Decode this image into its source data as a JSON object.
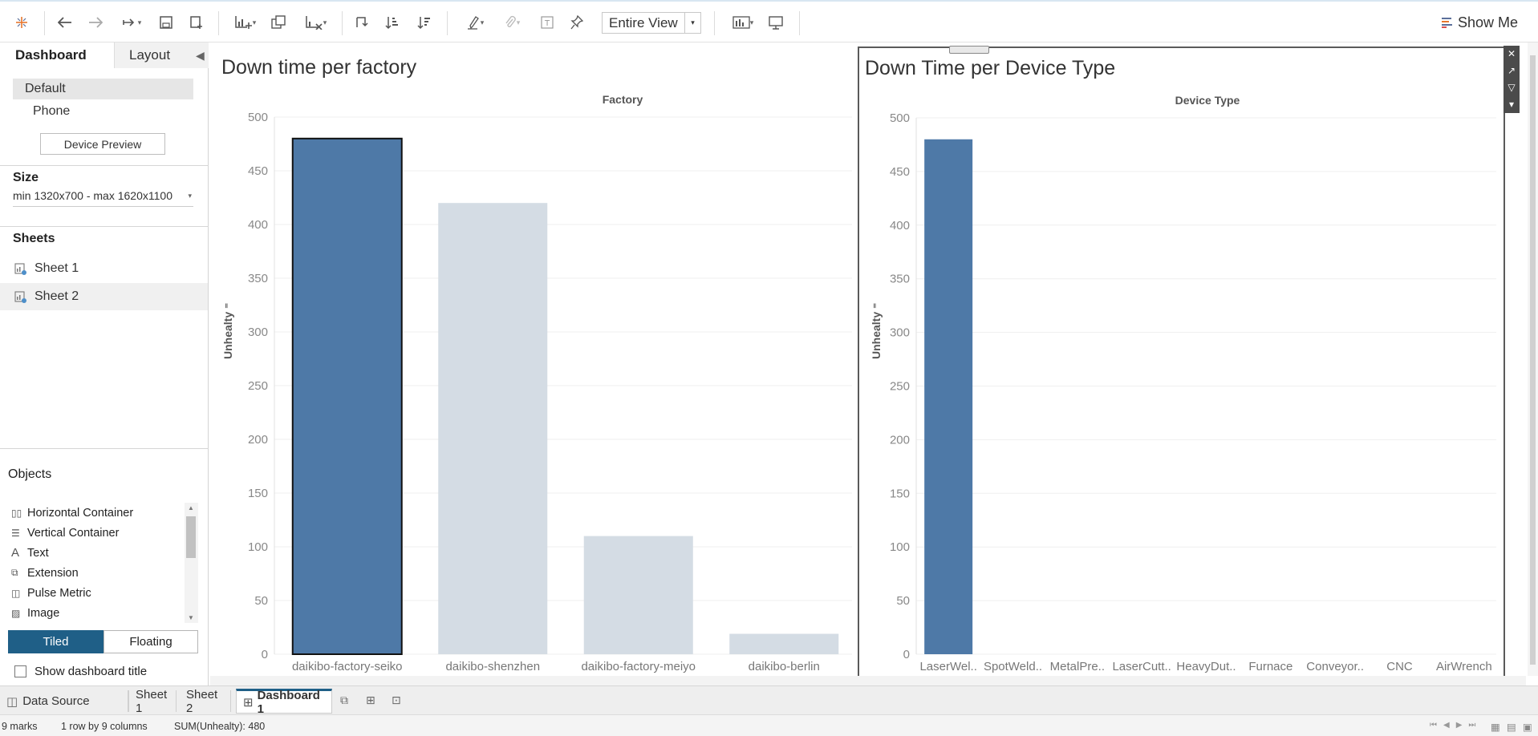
{
  "toolbar": {
    "view_select": "Entire View",
    "show_me": "Show Me",
    "icons": [
      "tableau-logo-icon",
      "undo-icon",
      "redo-icon",
      "replay-icon",
      "save-icon",
      "new-datasource-icon",
      "new-worksheet-icon",
      "duplicate-icon",
      "clear-icon",
      "swap-icon",
      "sort-ascending-icon",
      "sort-descending-icon",
      "highlight-icon",
      "attach-icon",
      "text-label-icon",
      "pin-icon",
      "view-size-icon",
      "presentation-icon"
    ]
  },
  "left_panel": {
    "tabs": [
      "Dashboard",
      "Layout"
    ],
    "device_options": [
      "Default",
      "Phone"
    ],
    "device_preview": "Device Preview",
    "size_title": "Size",
    "size_value": "min 1320x700 - max 1620x1100",
    "sheets_title": "Sheets",
    "sheets": [
      "Sheet 1",
      "Sheet 2"
    ],
    "objects_title": "Objects",
    "objects": [
      {
        "label": "Horizontal Container",
        "icon": "horizontal-container-icon"
      },
      {
        "label": "Vertical Container",
        "icon": "vertical-container-icon"
      },
      {
        "label": "Text",
        "icon": "text-icon"
      },
      {
        "label": "Extension",
        "icon": "extension-icon"
      },
      {
        "label": "Pulse Metric",
        "icon": "pulse-metric-icon"
      },
      {
        "label": "Image",
        "icon": "image-icon"
      }
    ],
    "tiled": "Tiled",
    "floating": "Floating",
    "show_title": "Show dashboard title"
  },
  "chart_data": [
    {
      "type": "bar",
      "title": "Down time per factory",
      "xlabel": "Factory",
      "ylabel": "Unhealty",
      "categories": [
        "daikibo-factory-seiko",
        "daikibo-shenzhen",
        "daikibo-factory-meiyo",
        "daikibo-berlin"
      ],
      "values": [
        480,
        420,
        110,
        19
      ],
      "selected": [
        true,
        false,
        false,
        false
      ],
      "yticks": [
        0,
        50,
        100,
        150,
        200,
        250,
        300,
        350,
        400,
        450,
        500
      ],
      "ylim": [
        0,
        500
      ],
      "colors": {
        "selected": "#4e79a7",
        "unselected": "#d4dce4"
      }
    },
    {
      "type": "bar",
      "title": "Down Time per Device Type",
      "xlabel": "Device Type",
      "ylabel": "Unhealty",
      "categories": [
        "LaserWel..",
        "SpotWeld..",
        "MetalPre..",
        "LaserCutt..",
        "HeavyDut..",
        "Furnace",
        "Conveyor..",
        "CNC",
        "AirWrench"
      ],
      "values": [
        480,
        0,
        0,
        0,
        0,
        0,
        0,
        0,
        0
      ],
      "yticks": [
        0,
        50,
        100,
        150,
        200,
        250,
        300,
        350,
        400,
        450,
        500
      ],
      "ylim": [
        0,
        500
      ],
      "colors": {
        "selected": "#4e79a7"
      }
    }
  ],
  "bottom_tabs": [
    "Data Source",
    "Sheet 1",
    "Sheet 2",
    "Dashboard 1"
  ],
  "status": {
    "marks": "9 marks",
    "rows": "1 row by 9 columns",
    "sum": "SUM(Unhealty): 480"
  }
}
